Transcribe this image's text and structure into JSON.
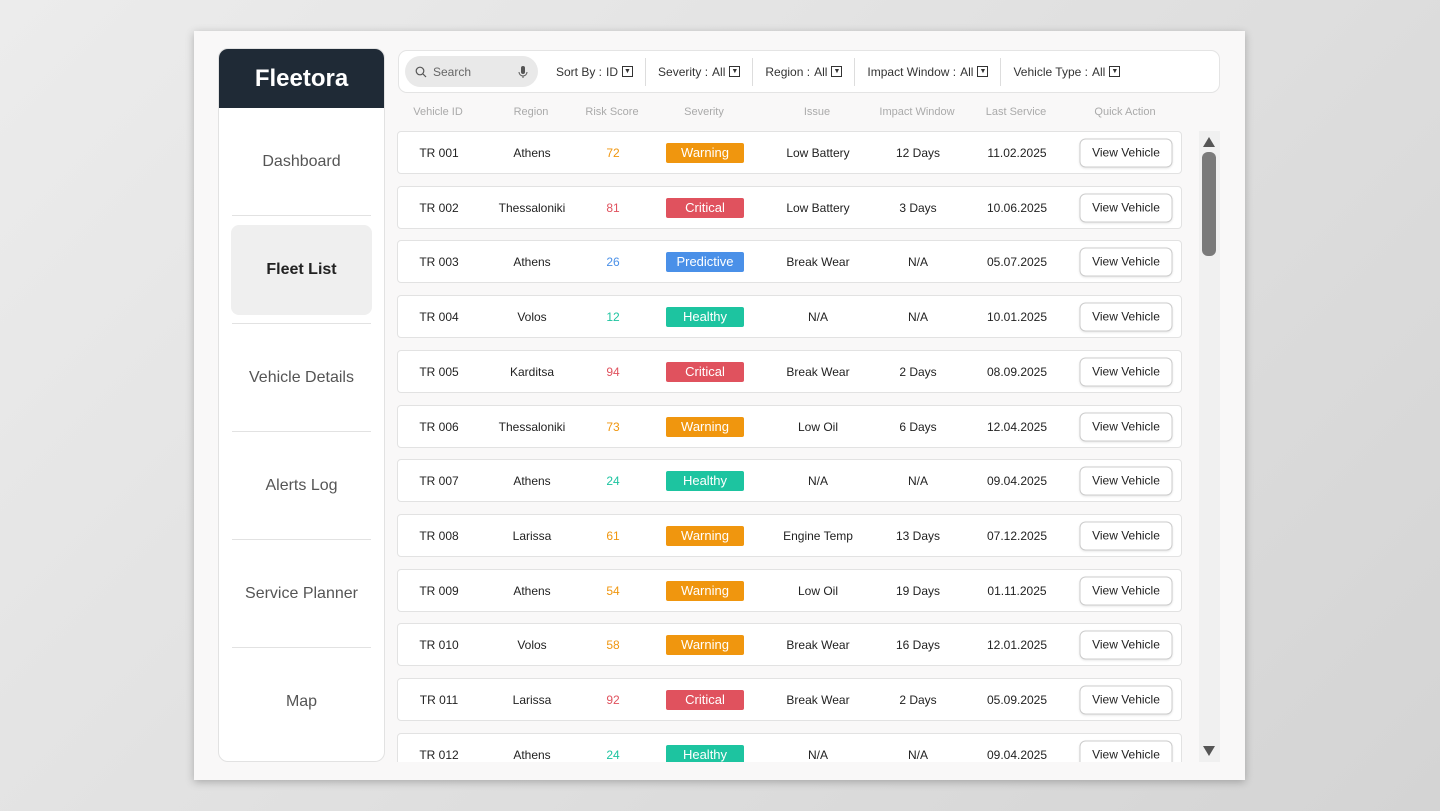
{
  "app": {
    "title": "Fleetora"
  },
  "nav": [
    {
      "label": "Dashboard"
    },
    {
      "label": "Fleet List",
      "active": true
    },
    {
      "label": "Vehicle Details"
    },
    {
      "label": "Alerts Log"
    },
    {
      "label": "Service Planner"
    },
    {
      "label": "Map"
    }
  ],
  "search": {
    "placeholder": "Search"
  },
  "filters": [
    {
      "label": "Sort By :",
      "value": "ID"
    },
    {
      "label": "Severity :",
      "value": "All"
    },
    {
      "label": "Region :",
      "value": "All"
    },
    {
      "label": "Impact Window :",
      "value": "All"
    },
    {
      "label": "Vehicle Type :",
      "value": "All"
    }
  ],
  "columns": [
    "Vehicle ID",
    "Region",
    "Risk Score",
    "Severity",
    "Issue",
    "Impact Window",
    "Last Service",
    "Quick Action"
  ],
  "severity_colors": {
    "Warning": "#f0960e",
    "Critical": "#e0525e",
    "Predictive": "#4a90e8",
    "Healthy": "#1dc4a0"
  },
  "action_label": "View Vehicle",
  "rows": [
    {
      "id": "TR 001",
      "region": "Athens",
      "risk": "72",
      "severity": "Warning",
      "issue": "Low Battery",
      "impact": "12 Days",
      "service": "11.02.2025"
    },
    {
      "id": "TR 002",
      "region": "Thessaloniki",
      "risk": "81",
      "severity": "Critical",
      "issue": "Low Battery",
      "impact": "3 Days",
      "service": "10.06.2025"
    },
    {
      "id": "TR 003",
      "region": "Athens",
      "risk": "26",
      "severity": "Predictive",
      "issue": "Break Wear",
      "impact": "N/A",
      "service": "05.07.2025"
    },
    {
      "id": "TR 004",
      "region": "Volos",
      "risk": "12",
      "severity": "Healthy",
      "issue": "N/A",
      "impact": "N/A",
      "service": "10.01.2025"
    },
    {
      "id": "TR 005",
      "region": "Karditsa",
      "risk": "94",
      "severity": "Critical",
      "issue": "Break Wear",
      "impact": "2 Days",
      "service": "08.09.2025"
    },
    {
      "id": "TR 006",
      "region": "Thessaloniki",
      "risk": "73",
      "severity": "Warning",
      "issue": "Low Oil",
      "impact": "6 Days",
      "service": "12.04.2025"
    },
    {
      "id": "TR 007",
      "region": "Athens",
      "risk": "24",
      "severity": "Healthy",
      "issue": "N/A",
      "impact": "N/A",
      "service": "09.04.2025"
    },
    {
      "id": "TR 008",
      "region": "Larissa",
      "risk": "61",
      "severity": "Warning",
      "issue": "Engine Temp",
      "impact": "13 Days",
      "service": "07.12.2025"
    },
    {
      "id": "TR 009",
      "region": "Athens",
      "risk": "54",
      "severity": "Warning",
      "issue": "Low Oil",
      "impact": "19 Days",
      "service": "01.11.2025"
    },
    {
      "id": "TR 010",
      "region": "Volos",
      "risk": "58",
      "severity": "Warning",
      "issue": "Break Wear",
      "impact": "16 Days",
      "service": "12.01.2025"
    },
    {
      "id": "TR 011",
      "region": "Larissa",
      "risk": "92",
      "severity": "Critical",
      "issue": "Break Wear",
      "impact": "2 Days",
      "service": "05.09.2025"
    },
    {
      "id": "TR 012",
      "region": "Athens",
      "risk": "24",
      "severity": "Healthy",
      "issue": "N/A",
      "impact": "N/A",
      "service": "09.04.2025"
    }
  ]
}
